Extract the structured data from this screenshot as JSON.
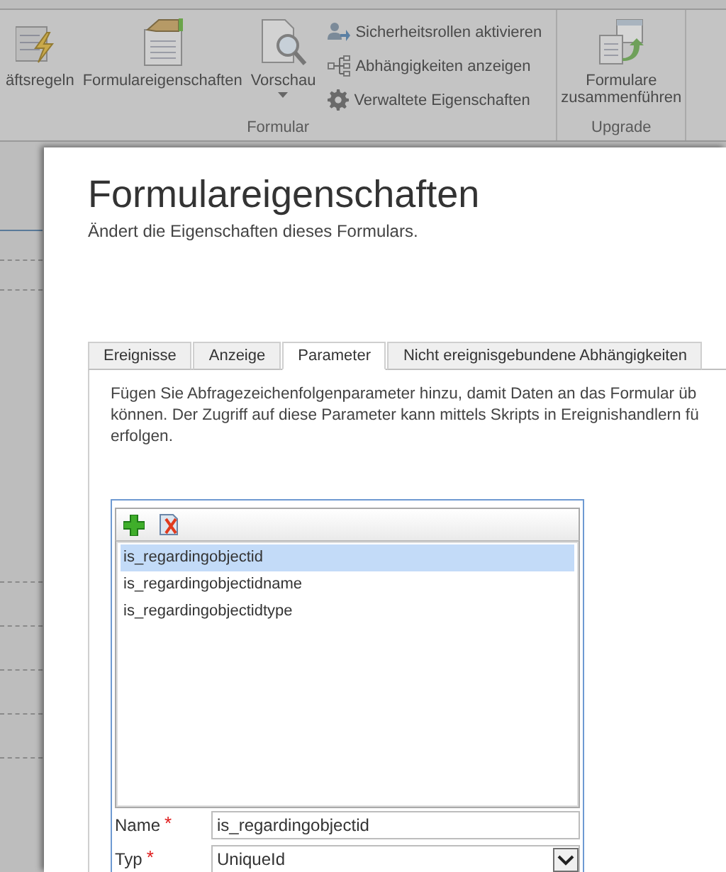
{
  "ribbon": {
    "groups": [
      {
        "label": "Formular",
        "large": [
          {
            "label": "äftsregeln",
            "dropdown": false
          },
          {
            "label": "Formulareigenschaften",
            "dropdown": false
          },
          {
            "label": "Vorschau",
            "dropdown": true
          }
        ],
        "small": [
          {
            "label": "Sicherheitsrollen aktivieren"
          },
          {
            "label": "Abhängigkeiten anzeigen"
          },
          {
            "label": "Verwaltete Eigenschaften"
          }
        ]
      },
      {
        "label": "Upgrade",
        "large": [
          {
            "label": "Formulare zusammenführen",
            "dropdown": false
          }
        ]
      }
    ]
  },
  "dialog": {
    "title": "Formulareigenschaften",
    "subtitle": "Ändert die Eigenschaften dieses Formulars.",
    "tabs": [
      {
        "label": "Ereignisse",
        "selected": false
      },
      {
        "label": "Anzeige",
        "selected": false
      },
      {
        "label": "Parameter",
        "selected": true
      },
      {
        "label": "Nicht ereignisgebundene Abhängigkeiten",
        "selected": false
      }
    ],
    "description": [
      "Fügen Sie Abfragezeichenfolgenparameter hinzu, damit Daten an das Formular üb",
      "können. Der Zugriff auf diese Parameter kann mittels Skripts in Ereignishandlern fü",
      "erfolgen."
    ],
    "parameters": [
      {
        "name": "is_regardingobjectid",
        "selected": true
      },
      {
        "name": "is_regardingobjectidname",
        "selected": false
      },
      {
        "name": "is_regardingobjectidtype",
        "selected": false
      }
    ],
    "fields": [
      {
        "kind": "text",
        "label": "Name",
        "required_mark": "*",
        "value": "is_regardingobjectid"
      },
      {
        "kind": "select",
        "label": "Typ",
        "required_mark": "*",
        "value": "UniqueId"
      }
    ]
  }
}
